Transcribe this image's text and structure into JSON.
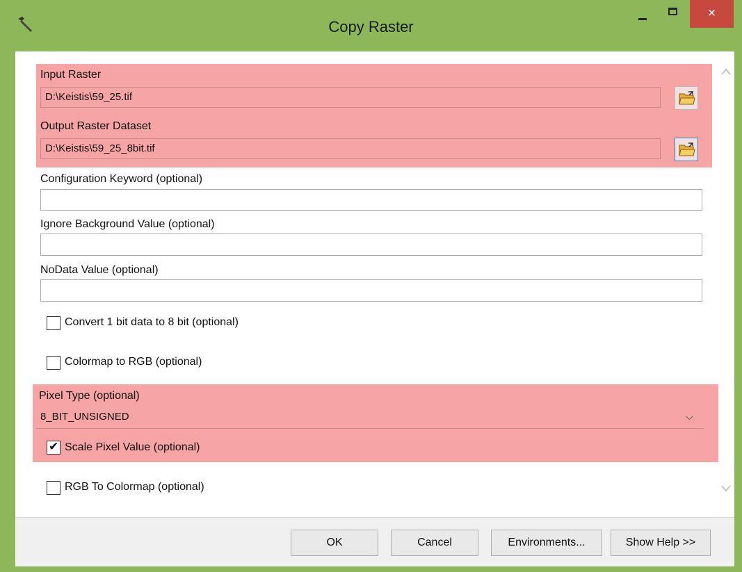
{
  "window": {
    "title": "Copy Raster",
    "close_glyph": "×"
  },
  "params": {
    "input_raster": {
      "label": "Input Raster",
      "value": "D:\\Keistis\\59_25.tif"
    },
    "output_raster": {
      "label": "Output Raster Dataset",
      "value": "D:\\Keistis\\59_25_8bit.tif"
    },
    "config_keyword": {
      "label": "Configuration Keyword (optional)",
      "value": ""
    },
    "ignore_background": {
      "label": "Ignore Background Value (optional)",
      "value": ""
    },
    "nodata_value": {
      "label": "NoData Value (optional)",
      "value": ""
    },
    "convert_1bit": {
      "label": "Convert 1 bit data to 8 bit (optional)",
      "checked": false
    },
    "colormap_to_rgb": {
      "label": "Colormap to RGB (optional)",
      "checked": false
    },
    "pixel_type": {
      "label": "Pixel Type (optional)",
      "value": "8_BIT_UNSIGNED"
    },
    "scale_pixel": {
      "label": "Scale Pixel Value (optional)",
      "checked": true
    },
    "rgb_to_colormap": {
      "label": "RGB To Colormap (optional)",
      "checked": false
    }
  },
  "buttons": {
    "ok": "OK",
    "cancel": "Cancel",
    "environments": "Environments...",
    "show_help": "Show Help >>"
  },
  "icons": {
    "app": "hammer-icon",
    "browse": "open-folder-icon",
    "dropdown": "chevron-down-icon"
  },
  "colors": {
    "highlight": "#f6a4a4",
    "titlebar": "#8cb85a",
    "close": "#c7483c"
  }
}
